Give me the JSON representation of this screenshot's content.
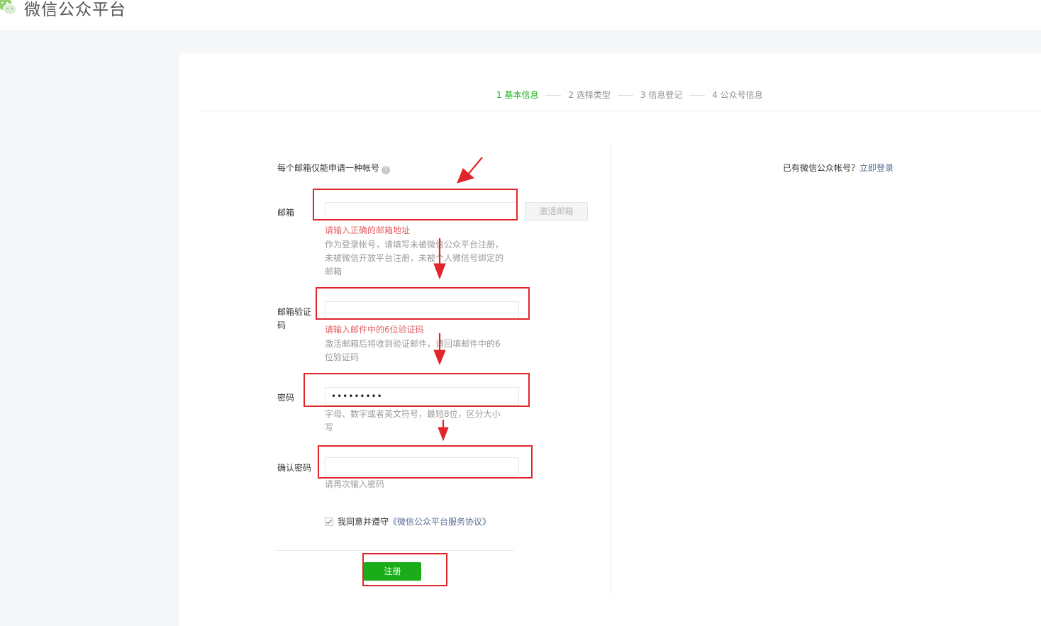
{
  "header": {
    "title": "微信公众平台",
    "logo_icon": "wechat-logo-icon"
  },
  "steps": [
    {
      "label": "1 基本信息",
      "active": true
    },
    {
      "label": "2 选择类型",
      "active": false
    },
    {
      "label": "3 信息登记",
      "active": false
    },
    {
      "label": "4 公众号信息",
      "active": false
    }
  ],
  "form": {
    "notice": "每个邮箱仅能申请一种帐号",
    "notice_help_icon": "question-circle-icon",
    "email": {
      "label": "邮箱",
      "value": "",
      "activate_button": "激活邮箱",
      "error": "请输入正确的邮箱地址",
      "tip": [
        "作为登录帐号，请填写未被微信公众平台注册，",
        "未被微信开放平台注册，未被个人微信号绑定的",
        "邮箱"
      ]
    },
    "verify_code": {
      "label_line1": "邮箱验证",
      "label_line2": "码",
      "value": "",
      "error": "请输入邮件中的6位验证码",
      "tip": [
        "激活邮箱后将收到验证邮件，请回填邮件中的6",
        "位验证码"
      ]
    },
    "password": {
      "label": "密码",
      "value": "•••••••••",
      "tip": [
        "字母、数字或者英文符号，最短8位，区分大小",
        "写"
      ]
    },
    "confirm_password": {
      "label": "确认密码",
      "value": "",
      "tip": "请再次输入密码"
    },
    "agreement": {
      "checked": true,
      "text": "我同意并遵守",
      "link": "《微信公众平台服务协议》"
    },
    "submit": "注册"
  },
  "side": {
    "text": "已有微信公众帐号？",
    "link": "立即登录"
  },
  "colors": {
    "accent_green": "#1aad19",
    "error_red": "#e15f63",
    "link_blue": "#576b95",
    "annotation_red": "#e0262a"
  }
}
